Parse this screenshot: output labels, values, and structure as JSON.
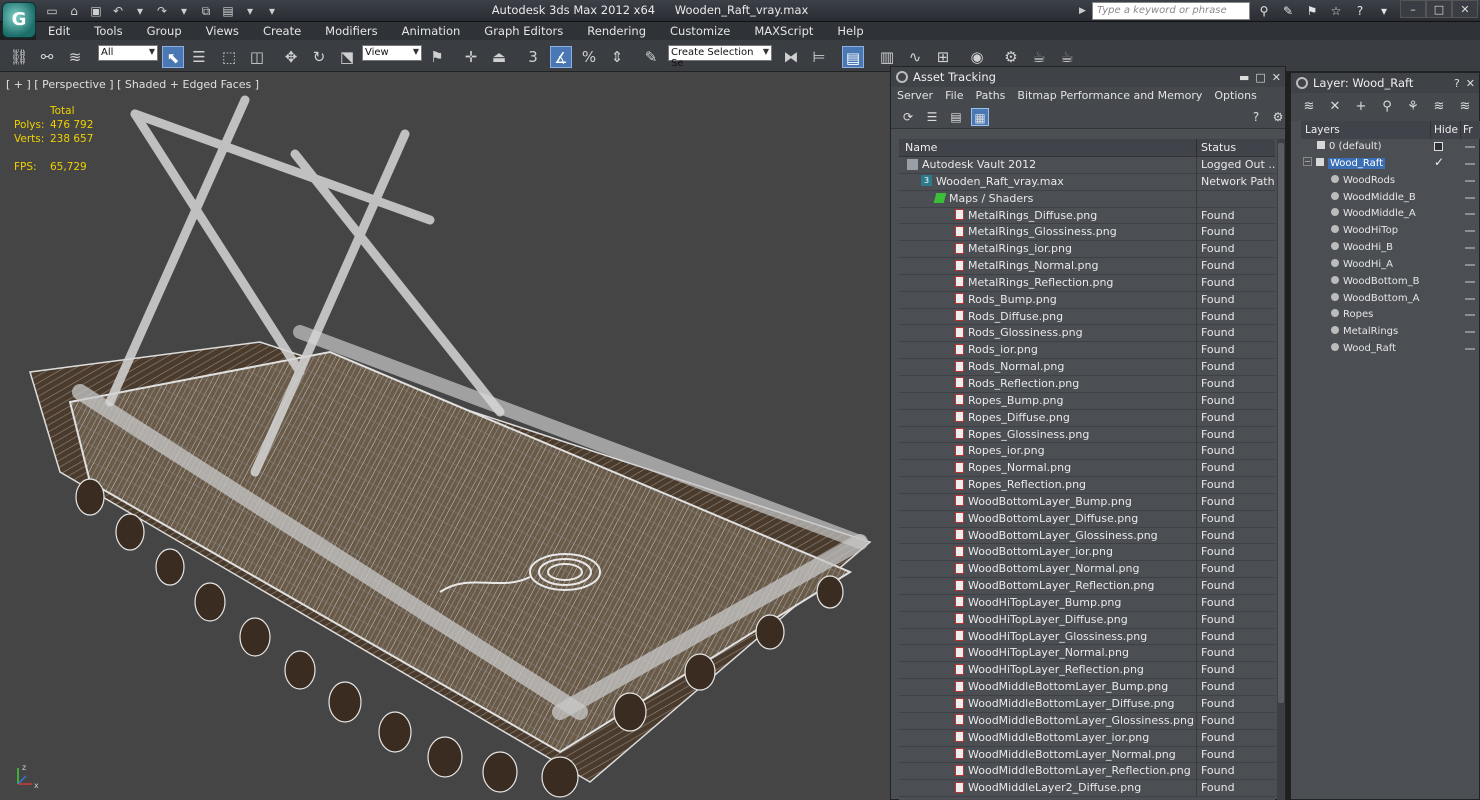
{
  "title_bar": {
    "app_name": "Autodesk 3ds Max  2012 x64",
    "file_name": "Wooden_Raft_vray.max",
    "search_placeholder": "Type a keyword or phrase"
  },
  "menu": [
    "Edit",
    "Tools",
    "Group",
    "Views",
    "Create",
    "Modifiers",
    "Animation",
    "Graph Editors",
    "Rendering",
    "Customize",
    "MAXScript",
    "Help"
  ],
  "toolbar": {
    "filter_value": "All",
    "reference_coord": "View",
    "selection_set_placeholder": "Create Selection Se"
  },
  "viewport": {
    "label": "[ + ] [ Perspective ] [ Shaded + Edged Faces ]",
    "stats_header": "Total",
    "polys_label": "Polys:",
    "polys_value": "476 792",
    "verts_label": "Verts:",
    "verts_value": "238 657",
    "fps_label": "FPS:",
    "fps_value": "65,729"
  },
  "asset_tracking": {
    "title": "Asset Tracking",
    "menu": [
      "Server",
      "File",
      "Paths",
      "Bitmap Performance and Memory",
      "Options"
    ],
    "columns": {
      "name": "Name",
      "status": "Status"
    },
    "rows": [
      {
        "name": "Autodesk Vault 2012",
        "status": "Logged Out ...",
        "level": 1,
        "kind": "vault"
      },
      {
        "name": "Wooden_Raft_vray.max",
        "status": "Network Path",
        "level": 2,
        "kind": "max"
      },
      {
        "name": "Maps / Shaders",
        "status": "",
        "level": 3,
        "kind": "maps"
      },
      {
        "name": "MetalRings_Diffuse.png",
        "status": "Found",
        "level": 4,
        "kind": "file"
      },
      {
        "name": "MetalRings_Glossiness.png",
        "status": "Found",
        "level": 4,
        "kind": "file"
      },
      {
        "name": "MetalRings_ior.png",
        "status": "Found",
        "level": 4,
        "kind": "file"
      },
      {
        "name": "MetalRings_Normal.png",
        "status": "Found",
        "level": 4,
        "kind": "file"
      },
      {
        "name": "MetalRings_Reflection.png",
        "status": "Found",
        "level": 4,
        "kind": "file"
      },
      {
        "name": "Rods_Bump.png",
        "status": "Found",
        "level": 4,
        "kind": "file"
      },
      {
        "name": "Rods_Diffuse.png",
        "status": "Found",
        "level": 4,
        "kind": "file"
      },
      {
        "name": "Rods_Glossiness.png",
        "status": "Found",
        "level": 4,
        "kind": "file"
      },
      {
        "name": "Rods_ior.png",
        "status": "Found",
        "level": 4,
        "kind": "file"
      },
      {
        "name": "Rods_Normal.png",
        "status": "Found",
        "level": 4,
        "kind": "file"
      },
      {
        "name": "Rods_Reflection.png",
        "status": "Found",
        "level": 4,
        "kind": "file"
      },
      {
        "name": "Ropes_Bump.png",
        "status": "Found",
        "level": 4,
        "kind": "file"
      },
      {
        "name": "Ropes_Diffuse.png",
        "status": "Found",
        "level": 4,
        "kind": "file"
      },
      {
        "name": "Ropes_Glossiness.png",
        "status": "Found",
        "level": 4,
        "kind": "file"
      },
      {
        "name": "Ropes_ior.png",
        "status": "Found",
        "level": 4,
        "kind": "file"
      },
      {
        "name": "Ropes_Normal.png",
        "status": "Found",
        "level": 4,
        "kind": "file"
      },
      {
        "name": "Ropes_Reflection.png",
        "status": "Found",
        "level": 4,
        "kind": "file"
      },
      {
        "name": "WoodBottomLayer_Bump.png",
        "status": "Found",
        "level": 4,
        "kind": "file"
      },
      {
        "name": "WoodBottomLayer_Diffuse.png",
        "status": "Found",
        "level": 4,
        "kind": "file"
      },
      {
        "name": "WoodBottomLayer_Glossiness.png",
        "status": "Found",
        "level": 4,
        "kind": "file"
      },
      {
        "name": "WoodBottomLayer_ior.png",
        "status": "Found",
        "level": 4,
        "kind": "file"
      },
      {
        "name": "WoodBottomLayer_Normal.png",
        "status": "Found",
        "level": 4,
        "kind": "file"
      },
      {
        "name": "WoodBottomLayer_Reflection.png",
        "status": "Found",
        "level": 4,
        "kind": "file"
      },
      {
        "name": "WoodHiTopLayer_Bump.png",
        "status": "Found",
        "level": 4,
        "kind": "file"
      },
      {
        "name": "WoodHiTopLayer_Diffuse.png",
        "status": "Found",
        "level": 4,
        "kind": "file"
      },
      {
        "name": "WoodHiTopLayer_Glossiness.png",
        "status": "Found",
        "level": 4,
        "kind": "file"
      },
      {
        "name": "WoodHiTopLayer_Normal.png",
        "status": "Found",
        "level": 4,
        "kind": "file"
      },
      {
        "name": "WoodHiTopLayer_Reflection.png",
        "status": "Found",
        "level": 4,
        "kind": "file"
      },
      {
        "name": "WoodMiddleBottomLayer_Bump.png",
        "status": "Found",
        "level": 4,
        "kind": "file"
      },
      {
        "name": "WoodMiddleBottomLayer_Diffuse.png",
        "status": "Found",
        "level": 4,
        "kind": "file"
      },
      {
        "name": "WoodMiddleBottomLayer_Glossiness.png",
        "status": "Found",
        "level": 4,
        "kind": "file"
      },
      {
        "name": "WoodMiddleBottomLayer_ior.png",
        "status": "Found",
        "level": 4,
        "kind": "file"
      },
      {
        "name": "WoodMiddleBottomLayer_Normal.png",
        "status": "Found",
        "level": 4,
        "kind": "file"
      },
      {
        "name": "WoodMiddleBottomLayer_Reflection.png",
        "status": "Found",
        "level": 4,
        "kind": "file"
      },
      {
        "name": "WoodMiddleLayer2_Diffuse.png",
        "status": "Found",
        "level": 4,
        "kind": "file"
      }
    ]
  },
  "layer_panel": {
    "title": "Layer: Wood_Raft",
    "columns": {
      "layers": "Layers",
      "hide": "Hide",
      "freeze": "Fr"
    },
    "rows": [
      {
        "name": "0 (default)",
        "kind": "layer",
        "level": 1,
        "selected": false,
        "current": true
      },
      {
        "name": "Wood_Raft",
        "kind": "layer",
        "level": 1,
        "selected": true,
        "active": true
      },
      {
        "name": "WoodRods",
        "kind": "object",
        "level": 2
      },
      {
        "name": "WoodMiddle_B",
        "kind": "object",
        "level": 2
      },
      {
        "name": "WoodMiddle_A",
        "kind": "object",
        "level": 2
      },
      {
        "name": "WoodHiTop",
        "kind": "object",
        "level": 2
      },
      {
        "name": "WoodHi_B",
        "kind": "object",
        "level": 2
      },
      {
        "name": "WoodHi_A",
        "kind": "object",
        "level": 2
      },
      {
        "name": "WoodBottom_B",
        "kind": "object",
        "level": 2
      },
      {
        "name": "WoodBottom_A",
        "kind": "object",
        "level": 2
      },
      {
        "name": "Ropes",
        "kind": "object",
        "level": 2
      },
      {
        "name": "MetalRings",
        "kind": "object",
        "level": 2
      },
      {
        "name": "Wood_Raft",
        "kind": "object",
        "level": 2
      }
    ]
  },
  "colors": {
    "stats_text": "#f0d000",
    "selection": "#3b6fb5",
    "panel_bg": "#4b4e53",
    "viewport_bg": "#454545"
  }
}
